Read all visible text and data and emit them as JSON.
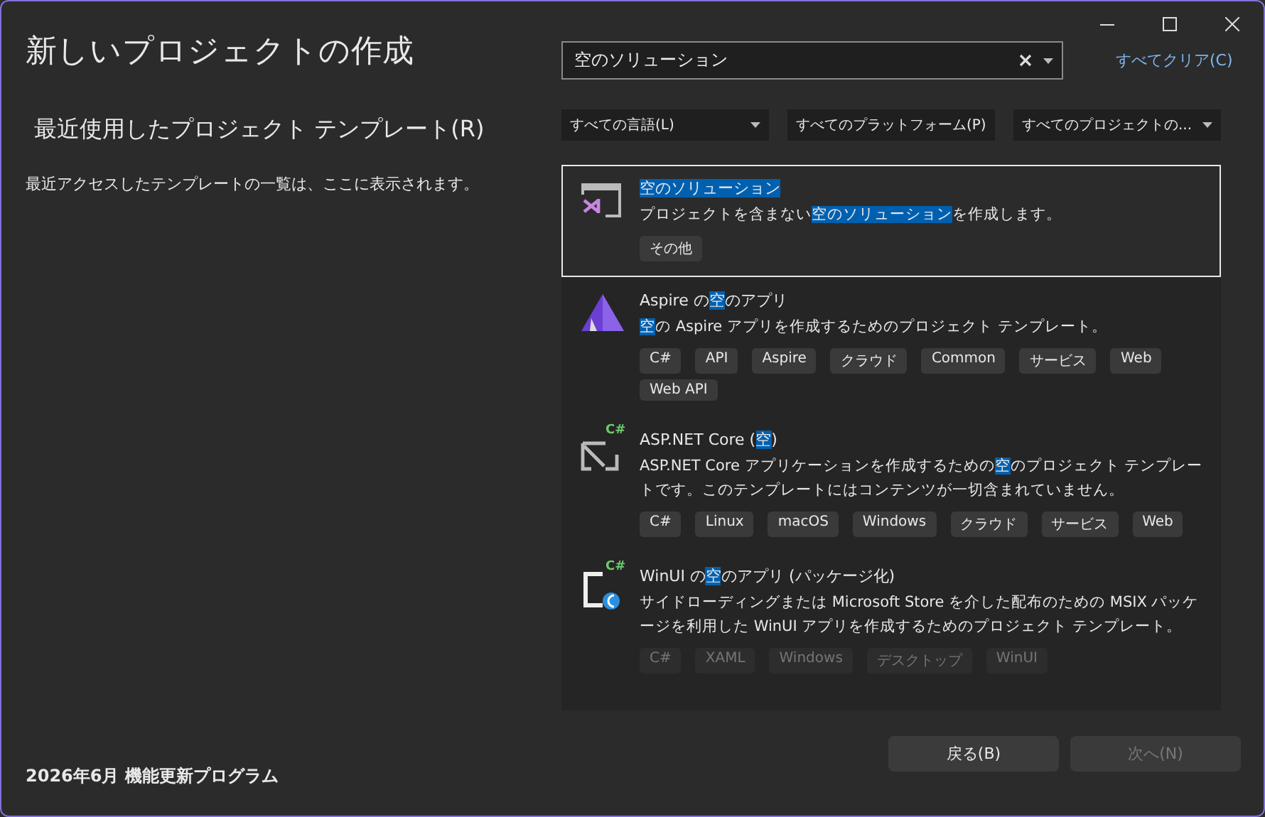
{
  "window": {
    "title": "新しいプロジェクトの作成"
  },
  "recent": {
    "heading": "最近使用したプロジェクト テンプレート(R)",
    "empty_text": "最近アクセスしたテンプレートの一覧は、ここに表示されます。"
  },
  "search": {
    "value": "空のソリューション",
    "clear_all": "すべてクリア(C)"
  },
  "filters": [
    {
      "label": "すべての言語(L)"
    },
    {
      "label": "すべてのプラットフォーム(P)"
    },
    {
      "label": "すべてのプロジェクトの..."
    }
  ],
  "templates": [
    {
      "selected": true,
      "dimmed": false,
      "title": [
        {
          "text": "空のソリューション",
          "match": true
        }
      ],
      "description": [
        {
          "text": "プロジェクトを含まない",
          "match": false
        },
        {
          "text": "空のソリューション",
          "match": true
        },
        {
          "text": "を作成します。",
          "match": false
        }
      ],
      "tags": [
        "その他"
      ]
    },
    {
      "selected": false,
      "dimmed": false,
      "title": [
        {
          "text": "Aspire の",
          "match": false
        },
        {
          "text": "空",
          "match": true
        },
        {
          "text": "のアプリ",
          "match": false
        }
      ],
      "description": [
        {
          "text": "空",
          "match": true
        },
        {
          "text": "の Aspire アプリを作成するためのプロジェクト テンプレート。",
          "match": false
        }
      ],
      "tags": [
        "C#",
        "API",
        "Aspire",
        "クラウド",
        "Common",
        "サービス",
        "Web",
        "Web API"
      ]
    },
    {
      "icon_badge": "C#",
      "selected": false,
      "dimmed": false,
      "title": [
        {
          "text": "ASP.NET Core (",
          "match": false
        },
        {
          "text": "空",
          "match": true
        },
        {
          "text": ")",
          "match": false
        }
      ],
      "description": [
        {
          "text": "ASP.NET Core アプリケーションを作成するための",
          "match": false
        },
        {
          "text": "空",
          "match": true
        },
        {
          "text": "のプロジェクト テンプレートです。このテンプレートにはコンテンツが一切含まれていません。",
          "match": false
        }
      ],
      "tags": [
        "C#",
        "Linux",
        "macOS",
        "Windows",
        "クラウド",
        "サービス",
        "Web"
      ]
    },
    {
      "icon_badge": "C#",
      "selected": false,
      "dimmed": true,
      "title": [
        {
          "text": "WinUI の",
          "match": false
        },
        {
          "text": "空",
          "match": true
        },
        {
          "text": "のアプリ (パッケージ化)",
          "match": false
        }
      ],
      "description": [
        {
          "text": "サイドローディングまたは Microsoft Store を介した配布のための MSIX パッケージを利用した WinUI アプリを作成するためのプロジェクト テンプレート。",
          "match": false
        }
      ],
      "tags": [
        "C#",
        "XAML",
        "Windows",
        "デスクトップ",
        "WinUI"
      ]
    }
  ],
  "footer": {
    "note": "2026年6月 機能更新プログラム",
    "buttons": [
      {
        "label": "戻る(B)",
        "disabled": false
      },
      {
        "label": "次へ(N)",
        "disabled": true
      }
    ]
  }
}
